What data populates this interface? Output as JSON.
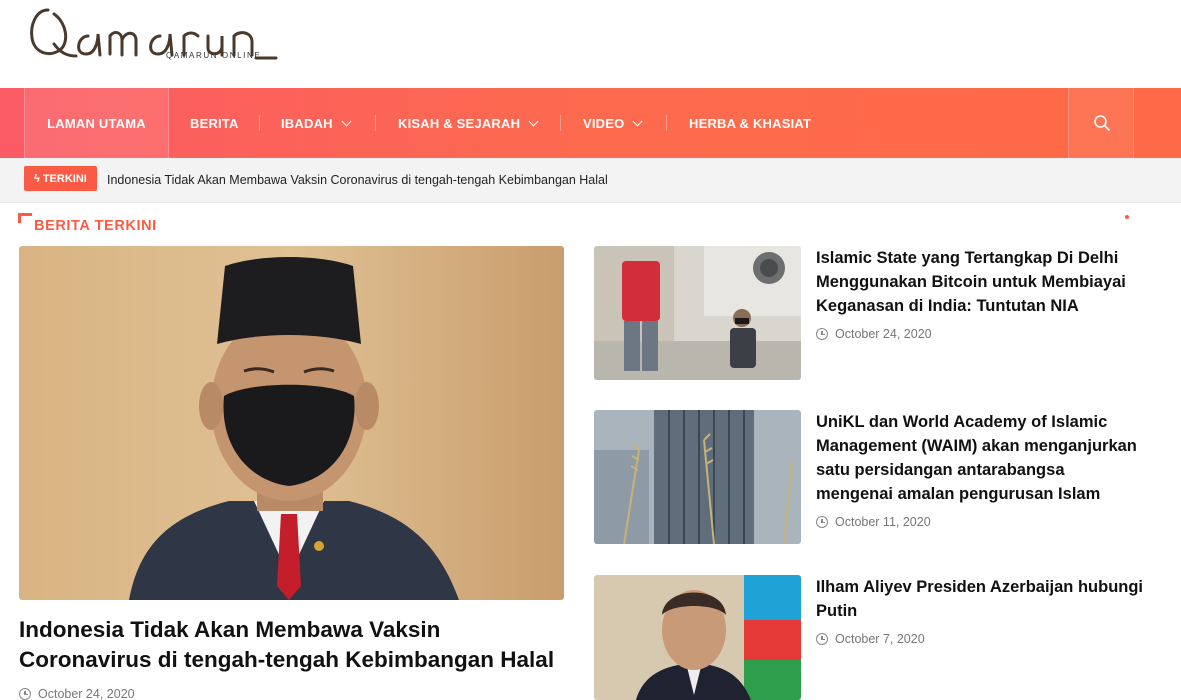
{
  "logo": {
    "wordmark": "Qamarun",
    "tagline": "QAMARUN ONLINE"
  },
  "nav": {
    "items": [
      {
        "label": "LAMAN UTAMA",
        "active": true
      },
      {
        "label": "BERITA"
      },
      {
        "label": "IBADAH",
        "dropdown": true
      },
      {
        "label": "KISAH & SEJARAH",
        "dropdown": true
      },
      {
        "label": "VIDEO",
        "dropdown": true
      },
      {
        "label": "HERBA & KHASIAT"
      }
    ],
    "search_icon": "search-icon"
  },
  "ticker": {
    "badge": "TERKINI",
    "badge_icon": "bolt-icon",
    "text": "Indonesia Tidak Akan Membawa Vaksin Coronavirus di tengah-tengah Kebimbangan Halal"
  },
  "section": {
    "title": "BERITA TERKINI"
  },
  "featured": {
    "title": "Indonesia Tidak Akan Membawa Vaksin Coronavirus di tengah-tengah Kebimbangan Halal",
    "date": "October 24, 2020"
  },
  "posts": [
    {
      "title": "Islamic State yang Tertangkap Di Delhi Menggunakan Bitcoin untuk Membiayai Keganasan di India: Tuntutan NIA",
      "date": "October 24, 2020"
    },
    {
      "title": "UniKL dan World Academy of Islamic Management (WAIM) akan menganjurkan satu persidangan antarabangsa mengenai amalan pengurusan Islam",
      "date": "October 11, 2020"
    },
    {
      "title": "Ilham Aliyev Presiden Azerbaijan hubungi Putin",
      "date": "October 7, 2020"
    }
  ],
  "colors": {
    "accent": "#fb5b45",
    "nav_start": "#fb5b64",
    "nav_end": "#fe6a47"
  }
}
